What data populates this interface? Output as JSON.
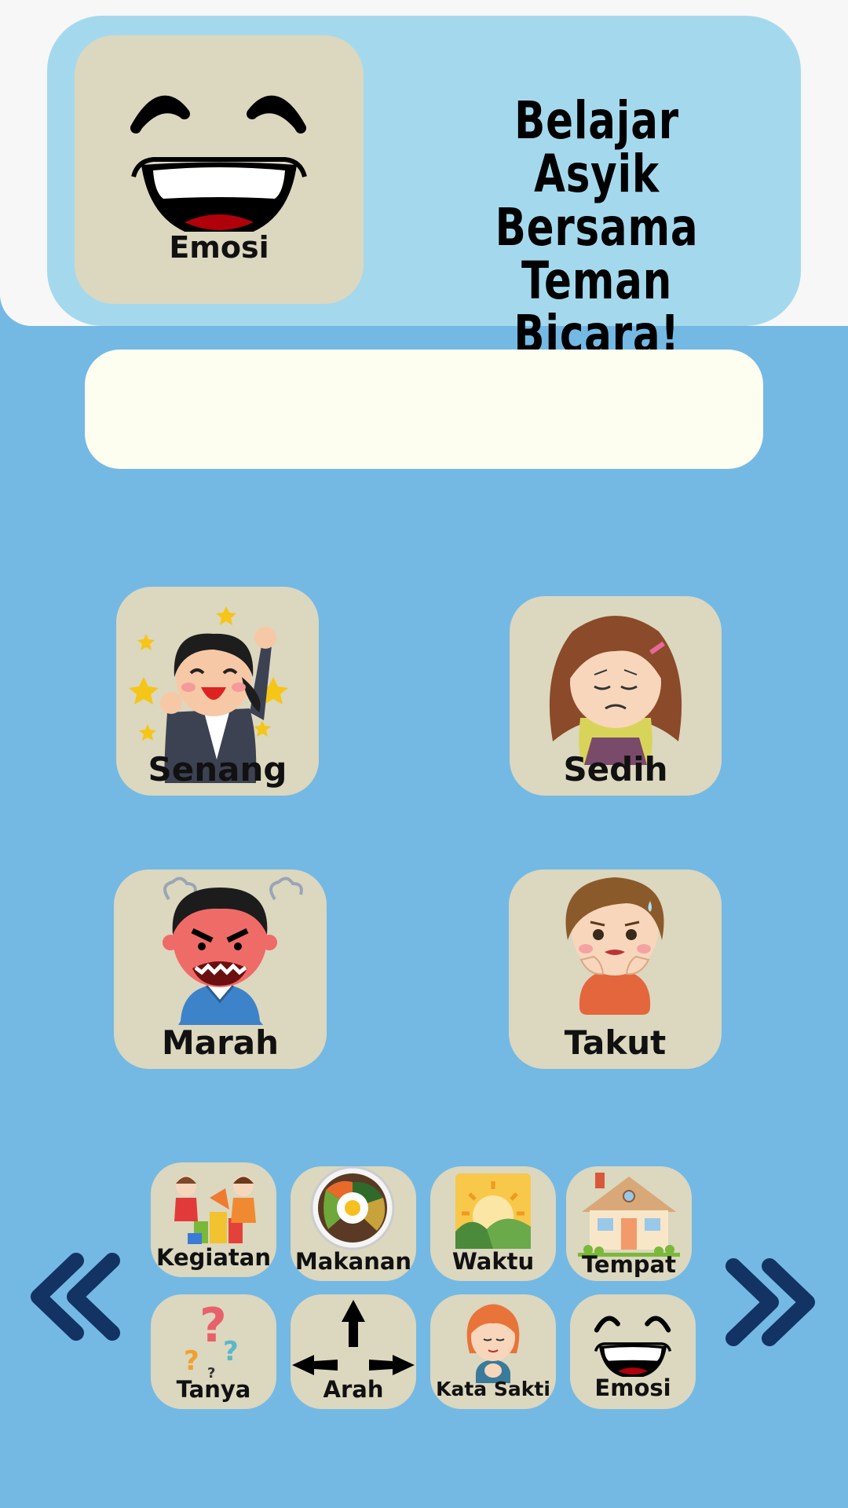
{
  "header": {
    "current_category": {
      "label": "Emosi",
      "icon": "laughing-face-icon"
    },
    "title_lines": [
      "Belajar Asyik",
      "Bersama",
      "Teman Bicara!"
    ]
  },
  "sentence_bar": {
    "text": ""
  },
  "emotions": [
    {
      "label": "Senang",
      "icon": "happy-woman-icon"
    },
    {
      "label": "Sedih",
      "icon": "sad-girl-icon"
    },
    {
      "label": "Marah",
      "icon": "angry-boy-icon"
    },
    {
      "label": "Takut",
      "icon": "scared-boy-icon"
    }
  ],
  "categories": [
    {
      "label": "Kegiatan",
      "icon": "kids-playing-icon"
    },
    {
      "label": "Makanan",
      "icon": "food-plate-icon"
    },
    {
      "label": "Waktu",
      "icon": "sun-mountain-icon"
    },
    {
      "label": "Tempat",
      "icon": "house-icon"
    },
    {
      "label": "Tanya",
      "icon": "question-marks-icon"
    },
    {
      "label": "Arah",
      "icon": "direction-arrows-icon"
    },
    {
      "label": "Kata Sakti",
      "icon": "girl-hands-icon"
    },
    {
      "label": "Emosi",
      "icon": "laughing-face-icon"
    }
  ],
  "colors": {
    "background": "#73b9e4",
    "header": "#a4d9ed",
    "card": "#dcd7bf",
    "chevron": "#123363"
  }
}
